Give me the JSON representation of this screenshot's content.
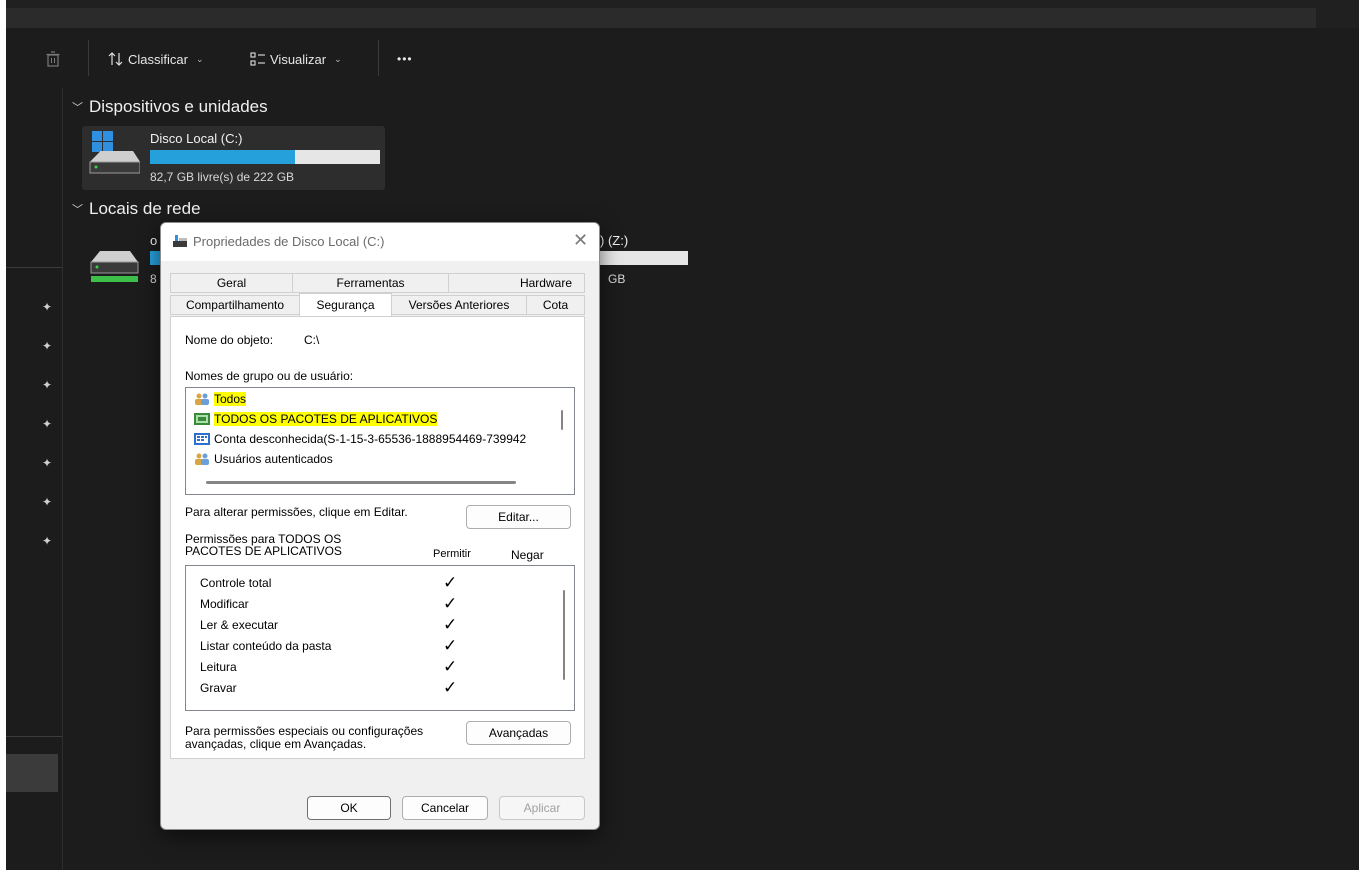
{
  "toolbar": {
    "sort_label": "Classificar",
    "view_label": "Visualizar",
    "more_label": "•••"
  },
  "sections": {
    "devices_title": "Dispositivos e unidades",
    "network_title": "Locais de rede"
  },
  "drives": [
    {
      "name": "Disco Local (C:)",
      "free_text": "82,7 GB livre(s) de 222 GB",
      "used_fraction": 0.63
    }
  ],
  "network_drive": {
    "name_prefix": "o",
    "name_suffix": ") (Z:)",
    "free_prefix": "8",
    "free_suffix": "GB",
    "used_fraction": 0.64
  },
  "dialog": {
    "title": "Propriedades de Disco Local (C:)",
    "tabs_row1": [
      "Geral",
      "Ferramentas",
      "Hardware"
    ],
    "tabs_row2": [
      "Compartilhamento",
      "Segurança",
      "Versões Anteriores",
      "Cota"
    ],
    "active_tab": "Segurança",
    "object_label": "Nome do objeto:",
    "object_value": "C:\\",
    "groups_label": "Nomes de grupo ou de usuário:",
    "groups": [
      {
        "name": "Todos",
        "icon": "users-icon",
        "highlighted": true
      },
      {
        "name": "TODOS OS PACOTES DE APLICATIVOS",
        "icon": "app-package-icon",
        "highlighted": true
      },
      {
        "name": "Conta desconhecida(S-1-15-3-65536-1888954469-739942",
        "icon": "unknown-account-icon",
        "highlighted": false
      },
      {
        "name": "Usuários autenticados",
        "icon": "users-icon",
        "highlighted": false
      }
    ],
    "change_perms_text": "Para alterar permissões, clique em Editar.",
    "edit_button": "Editar...",
    "perms_for_line1": "Permissões para TODOS OS",
    "perms_for_line2": "PACOTES DE APLICATIVOS",
    "allow_header": "Permitir",
    "deny_header": "Negar",
    "permissions": [
      {
        "name": "Controle total",
        "allow": true,
        "deny": false
      },
      {
        "name": "Modificar",
        "allow": true,
        "deny": false
      },
      {
        "name": "Ler & executar",
        "allow": true,
        "deny": false
      },
      {
        "name": "Listar conteúdo da pasta",
        "allow": true,
        "deny": false
      },
      {
        "name": "Leitura",
        "allow": true,
        "deny": false
      },
      {
        "name": "Gravar",
        "allow": true,
        "deny": false
      }
    ],
    "check_glyph": "✓",
    "advanced_text_line1": "Para permissões especiais ou configurações",
    "advanced_text_line2": "avançadas, clique em Avançadas.",
    "advanced_button": "Avançadas",
    "ok_button": "OK",
    "cancel_button": "Cancelar",
    "apply_button": "Aplicar",
    "close_glyph": "✕"
  },
  "colors": {
    "explorer_bg": "#1c1c1c",
    "drive_bar_fill": "#26a0da",
    "highlight": "#ffff00"
  }
}
